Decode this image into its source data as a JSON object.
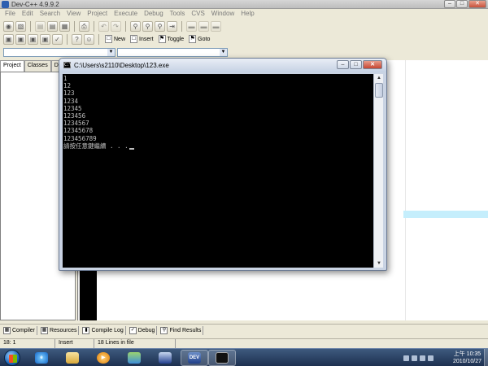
{
  "ide": {
    "title": "Dev-C++ 4.9.9.2",
    "menu": [
      "File",
      "Edit",
      "Search",
      "View",
      "Project",
      "Execute",
      "Debug",
      "Tools",
      "CVS",
      "Window",
      "Help"
    ],
    "toolbar2_buttons": {
      "new": "New",
      "insert": "Insert",
      "toggle": "Toggle",
      "goto": "Goto"
    },
    "left_tabs": [
      "Project",
      "Classes",
      "Debu"
    ],
    "bottom_tabs": [
      "Compiler",
      "Resources",
      "Compile Log",
      "Debug",
      "Find Results"
    ],
    "status": {
      "position": "18: 1",
      "mode": "Insert",
      "lines": "18 Lines in file"
    }
  },
  "console": {
    "title": "C:\\Users\\s2110\\Desktop\\123.exe",
    "lines": [
      "1",
      "12",
      "123",
      "1234",
      "12345",
      "123456",
      "1234567",
      "12345678",
      "123456789"
    ],
    "prompt": "請按任意鍵繼續 . . ."
  },
  "taskbar": {
    "dev_label": "DEV",
    "clock_time": "上午 10:35",
    "clock_date": "2010/10/27"
  }
}
